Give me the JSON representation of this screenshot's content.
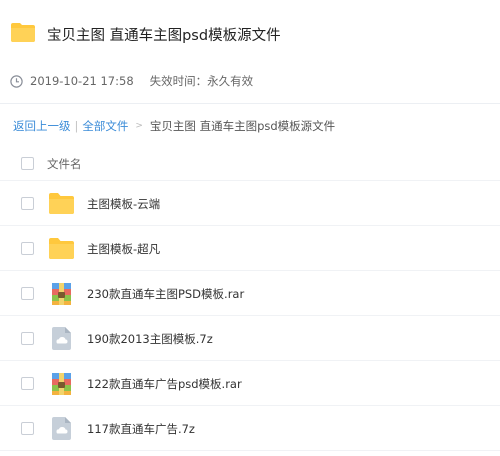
{
  "share": {
    "title": "宝贝主图 直通车主图psd模板源文件",
    "date": "2019-10-21 17:58",
    "expiry": "失效时间：永久有效"
  },
  "breadcrumb": {
    "back": "返回上一级",
    "separator": "|",
    "all_files": "全部文件",
    "arrow": ">",
    "current": "宝贝主图 直通车主图psd模板源文件"
  },
  "list": {
    "header": "文件名",
    "files": [
      {
        "name": "主图模板-云端",
        "icon": "folder-icon"
      },
      {
        "name": "主图模板-超凡",
        "icon": "folder-icon"
      },
      {
        "name": "230款直通车主图PSD模板.rar",
        "icon": "rar-archive-icon"
      },
      {
        "name": "190款2013主图模板.7z",
        "icon": "cloud-file-icon"
      },
      {
        "name": "122款直通车广告psd模板.rar",
        "icon": "rar-archive-icon"
      },
      {
        "name": "117款直通车广告.7z",
        "icon": "cloud-file-icon"
      }
    ]
  },
  "colors": {
    "link": "#3b8cd8",
    "folder": "#ffd257"
  }
}
